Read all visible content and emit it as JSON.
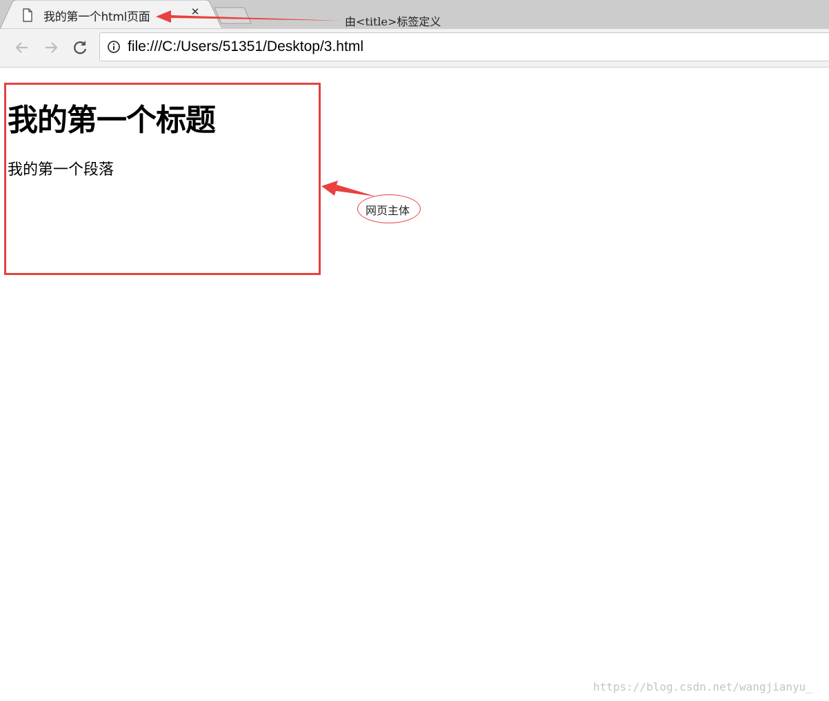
{
  "tab": {
    "title": "我的第一个html页面",
    "close_icon": "close-icon",
    "page_icon": "document-icon"
  },
  "toolbar": {
    "back_icon": "back-arrow-icon",
    "forward_icon": "forward-arrow-icon",
    "reload_icon": "reload-icon",
    "url": "file:///C:/Users/51351/Desktop/3.html",
    "info_icon": "info-icon"
  },
  "page": {
    "heading": "我的第一个标题",
    "paragraph": "我的第一个段落"
  },
  "annotations": {
    "title_note": "由<title>标签定义",
    "body_note": "网页主体",
    "color": "#e8413f"
  },
  "watermark": "https://blog.csdn.net/wangjianyu_"
}
